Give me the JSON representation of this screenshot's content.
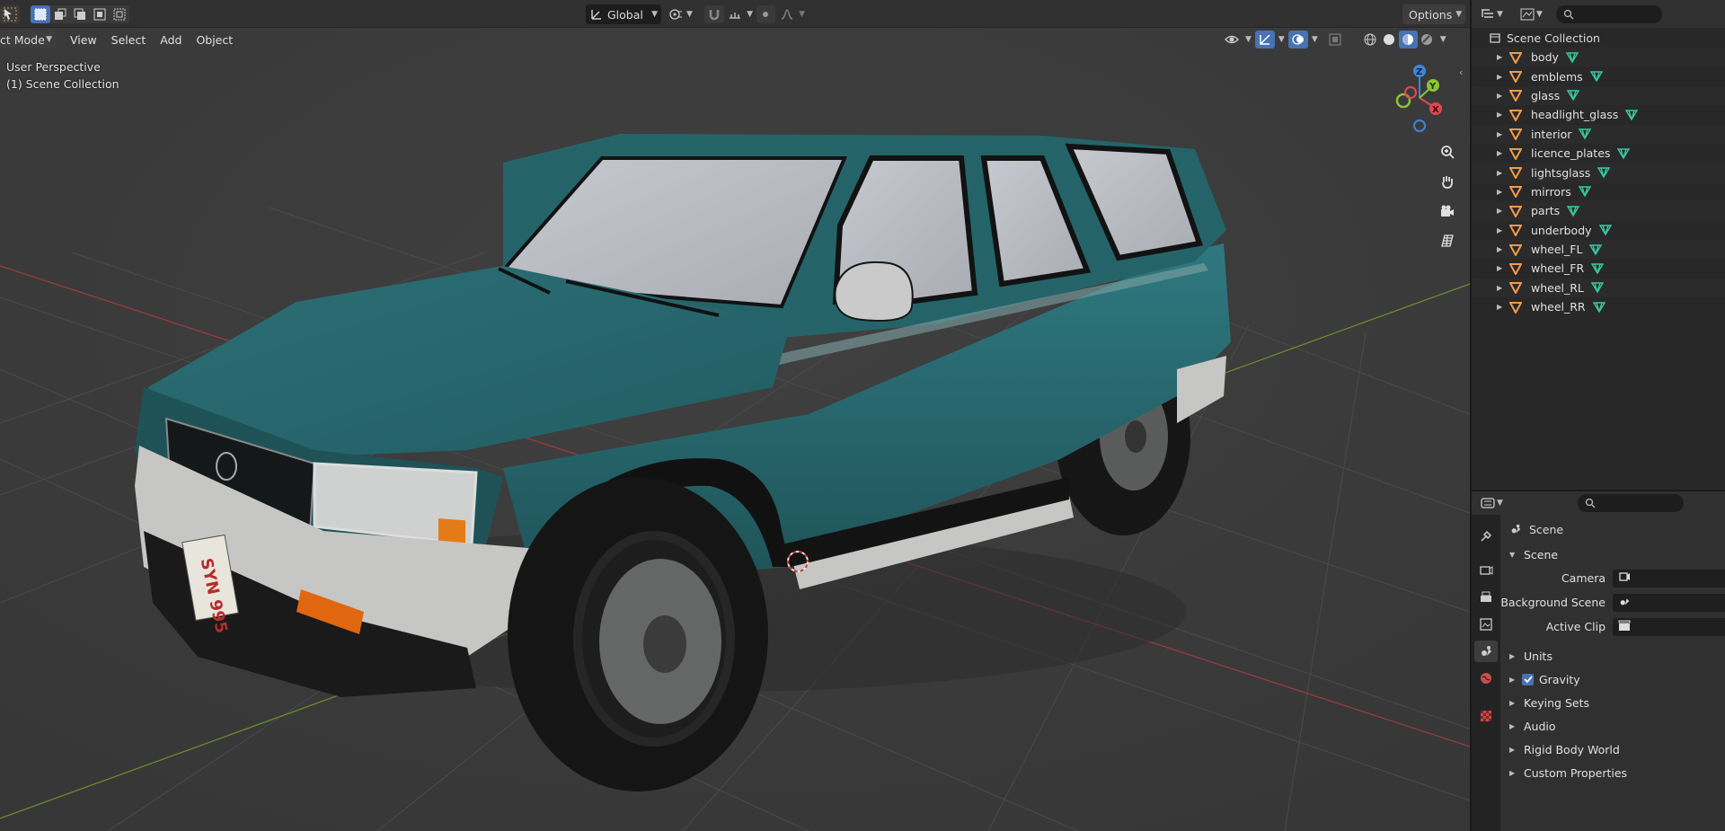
{
  "header": {
    "orientation_label": "Global",
    "options_label": "Options"
  },
  "viewport": {
    "mode_label": "ct Mode",
    "menu": [
      "View",
      "Select",
      "Add",
      "Object"
    ],
    "perspective_label": "User Perspective",
    "collection_label": "(1) Scene Collection",
    "gizmo_axes": {
      "x": "X",
      "y": "Y",
      "z": "Z"
    },
    "plate_text": "SYN 995"
  },
  "outliner": {
    "root_label": "Scene Collection",
    "objects": [
      "body",
      "emblems",
      "glass",
      "headlight_glass",
      "interior",
      "licence_plates",
      "lightsglass",
      "mirrors",
      "parts",
      "underbody",
      "wheel_FL",
      "wheel_FR",
      "wheel_RL",
      "wheel_RR"
    ]
  },
  "properties": {
    "context_label": "Scene",
    "panel_title": "Scene",
    "fields": [
      {
        "label": "Camera",
        "value": ""
      },
      {
        "label": "Background Scene",
        "value": ""
      },
      {
        "label": "Active Clip",
        "value": ""
      }
    ],
    "subpanels": [
      "Units",
      "Gravity",
      "Keying Sets",
      "Audio",
      "Rigid Body World",
      "Custom Properties"
    ],
    "gravity_checked": true
  },
  "colors": {
    "accent": "#4772b3",
    "car_body": "#2a6a70",
    "axis_x": "#e04850",
    "axis_y": "#8ac43a",
    "axis_z": "#3d86d8",
    "mesh_icon": "#36c9a1",
    "collection_icon": "#f39b4a"
  }
}
